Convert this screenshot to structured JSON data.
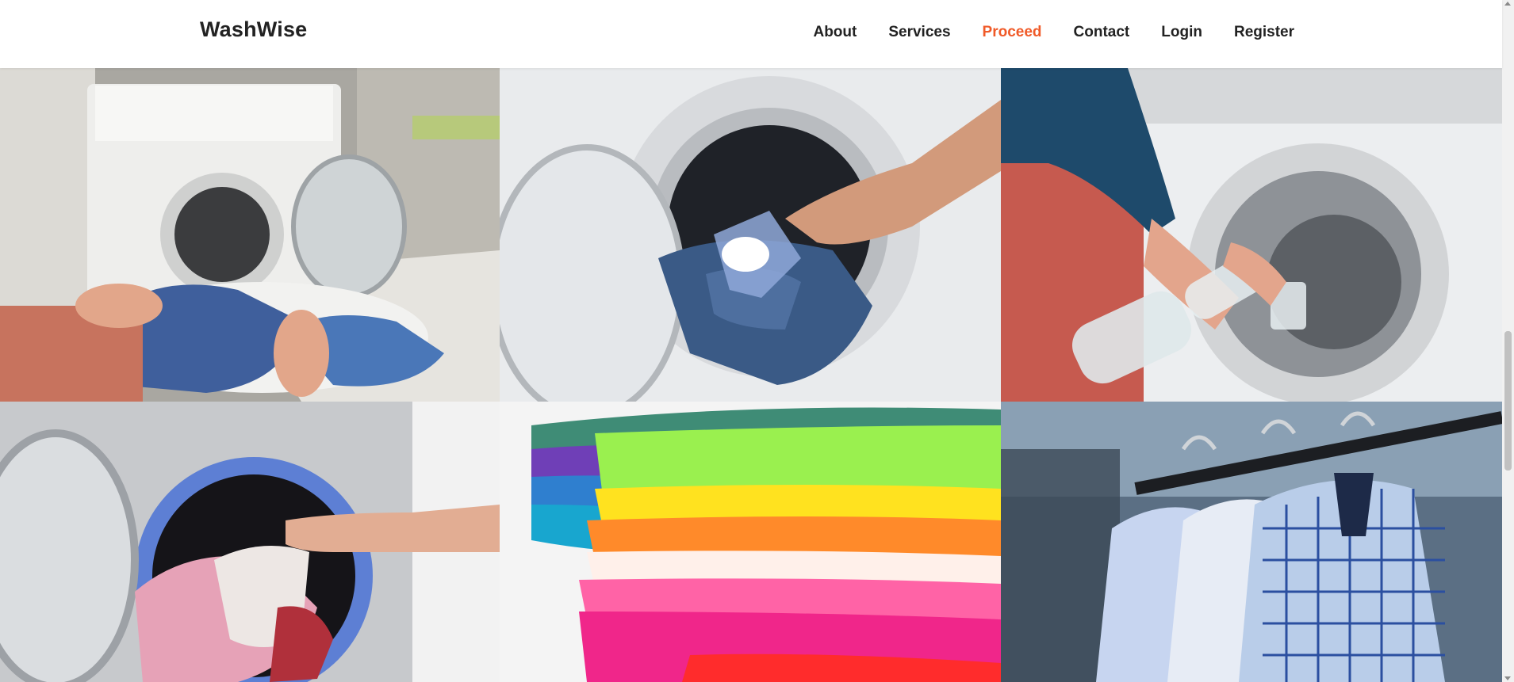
{
  "brand": "WashWise",
  "nav": {
    "about": "About",
    "services": "Services",
    "proceed": "Proceed",
    "contact": "Contact",
    "login": "Login",
    "register": "Register"
  },
  "colors": {
    "accent": "#f05a28",
    "text": "#222222"
  },
  "gallery": [
    "person sorting laundry in front of washing machine",
    "hand pouring detergent scoop into drum with jeans",
    "hands pouring vinegar into washing machine",
    "hand loading pink towels into washing machine",
    "stack of colorful folded shirts",
    "checked dress shirts on hangers"
  ]
}
